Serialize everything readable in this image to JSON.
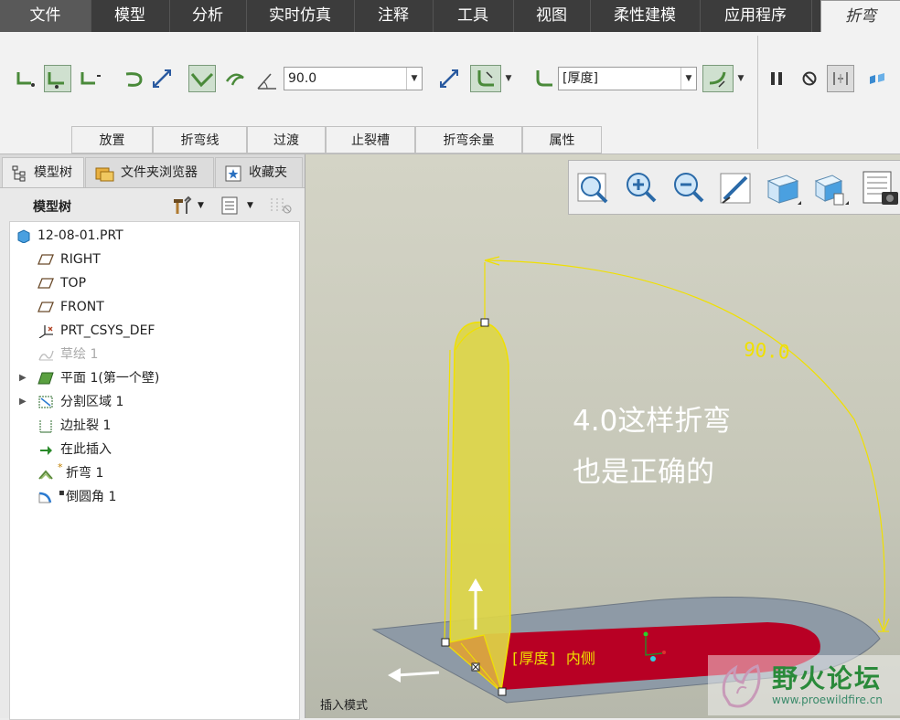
{
  "menu": {
    "tabs": [
      "文件",
      "模型",
      "分析",
      "实时仿真",
      "注释",
      "工具",
      "视图",
      "柔性建模",
      "应用程序"
    ],
    "active_tab": "折弯"
  },
  "ribbon": {
    "angle_value": "90.0",
    "thickness_value": "[厚度]",
    "subtabs": [
      "放置",
      "折弯线",
      "过渡",
      "止裂槽",
      "折弯余量",
      "属性"
    ]
  },
  "left_panel": {
    "tabs": [
      "模型树",
      "文件夹浏览器",
      "收藏夹"
    ],
    "tree_title": "模型树",
    "tree_items": [
      {
        "label": "12-08-01.PRT",
        "icon": "part-icon"
      },
      {
        "label": "RIGHT",
        "icon": "datum-plane-icon"
      },
      {
        "label": "TOP",
        "icon": "datum-plane-icon"
      },
      {
        "label": "FRONT",
        "icon": "datum-plane-icon"
      },
      {
        "label": "PRT_CSYS_DEF",
        "icon": "csys-icon"
      },
      {
        "label": "草绘 1",
        "icon": "sketch-icon"
      },
      {
        "label": "平面 1(第一个壁)",
        "icon": "planar-wall-icon"
      },
      {
        "label": "分割区域 1",
        "icon": "split-area-icon"
      },
      {
        "label": "边扯裂 1",
        "icon": "edge-rip-icon"
      },
      {
        "label": "在此插入",
        "icon": "insert-here-icon"
      },
      {
        "label": "折弯 1",
        "icon": "bend-icon"
      },
      {
        "label": "倒圆角 1",
        "icon": "round-icon"
      }
    ]
  },
  "viewport": {
    "dimension_label": "90.0",
    "annotation_line1": "4.0这样折弯",
    "annotation_line2": "也是正确的",
    "thickness_tag": "[厚度] 内侧",
    "mode_label": "插入模式",
    "watermark_text": "野火论坛",
    "watermark_url": "www.proewildfire.cn"
  },
  "colors": {
    "menubar": "#3c3c3c",
    "bend_yellow": "#f0e000",
    "wall_fill": "#d8d43a",
    "flange_red": "#b80024",
    "plate_gray": "#8e9aa6",
    "viewport_bg": "#c8c9bb"
  }
}
